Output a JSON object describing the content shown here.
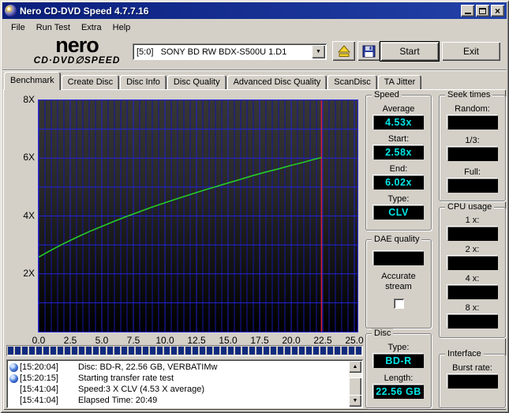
{
  "window": {
    "title": "Nero CD-DVD Speed 4.7.7.16"
  },
  "menu": {
    "items": [
      "File",
      "Run Test",
      "Extra",
      "Help"
    ]
  },
  "header": {
    "logo_line1": "nero",
    "logo_line2": "CD·DVD∅SPEED",
    "drive_selector_value": "[5:0]   SONY BD RW BDX-S500U 1.D1",
    "start_label": "Start",
    "exit_label": "Exit"
  },
  "tabs": {
    "items": [
      "Benchmark",
      "Create Disc",
      "Disc Info",
      "Disc Quality",
      "Advanced Disc Quality",
      "ScanDisc",
      "TA Jitter"
    ],
    "active": "Benchmark"
  },
  "chart_data": {
    "type": "line",
    "title": "",
    "xlabel": "",
    "ylabel": "",
    "xlim": [
      0,
      25.25
    ],
    "ylim": [
      0,
      8
    ],
    "x_ticks": [
      {
        "value": 0,
        "label": "0.0"
      },
      {
        "value": 2.5,
        "label": "2.5"
      },
      {
        "value": 5,
        "label": "5.0"
      },
      {
        "value": 7.5,
        "label": "7.5"
      },
      {
        "value": 10,
        "label": "10.0"
      },
      {
        "value": 12.5,
        "label": "12.5"
      },
      {
        "value": 15,
        "label": "15.0"
      },
      {
        "value": 17.5,
        "label": "17.5"
      },
      {
        "value": 20,
        "label": "20.0"
      },
      {
        "value": 22.5,
        "label": "22.5"
      },
      {
        "value": 25,
        "label": "25.0"
      }
    ],
    "y_ticks": [
      {
        "value": 8,
        "label": "8X"
      },
      {
        "value": 6,
        "label": "6X"
      },
      {
        "value": 4,
        "label": "4X"
      },
      {
        "value": 2,
        "label": "2X"
      }
    ],
    "grid": {
      "x_minor_step": 0.5,
      "x_major_every": 5,
      "y_step": 1
    },
    "series": [
      {
        "name": "read-transfer-rate",
        "points": [
          [
            0,
            2.58
          ],
          [
            1,
            2.82
          ],
          [
            2,
            3.05
          ],
          [
            3,
            3.26
          ],
          [
            4,
            3.46
          ],
          [
            5,
            3.64
          ],
          [
            6,
            3.82
          ],
          [
            7,
            3.99
          ],
          [
            8,
            4.15
          ],
          [
            9,
            4.31
          ],
          [
            10,
            4.46
          ],
          [
            11,
            4.6
          ],
          [
            12,
            4.74
          ],
          [
            13,
            4.88
          ],
          [
            14,
            5.01
          ],
          [
            15,
            5.14
          ],
          [
            16,
            5.27
          ],
          [
            17,
            5.4
          ],
          [
            18,
            5.52
          ],
          [
            19,
            5.63
          ],
          [
            20,
            5.75
          ],
          [
            21,
            5.86
          ],
          [
            22,
            5.98
          ],
          [
            22.4,
            6.02
          ]
        ]
      }
    ],
    "marker_line_x": 22.4,
    "legend": "none"
  },
  "panels": {
    "speed": {
      "title": "Speed",
      "average_label": "Average",
      "average": "4.53x",
      "start_label": "Start:",
      "start": "2.58x",
      "end_label": "End:",
      "end": "6.02x",
      "type_label": "Type:",
      "type": "CLV"
    },
    "seek": {
      "title": "Seek times",
      "random_label": "Random:",
      "random": "",
      "third_label": "1/3:",
      "third": "",
      "full_label": "Full:",
      "full": ""
    },
    "cpu": {
      "title": "CPU usage",
      "x1_label": "1 x:",
      "x1": "",
      "x2_label": "2 x:",
      "x2": "",
      "x4_label": "4 x:",
      "x4": "",
      "x8_label": "8 x:",
      "x8": ""
    },
    "dae": {
      "title": "DAE quality",
      "quality": "",
      "accurate_label_1": "Accurate",
      "accurate_label_2": "stream",
      "accurate_checked": false
    },
    "disc": {
      "title": "Disc",
      "type_label": "Type:",
      "type": "BD-R",
      "length_label": "Length:",
      "length": "22.56 GB"
    },
    "interface": {
      "title": "Interface",
      "burst_label": "Burst rate:",
      "burst": ""
    }
  },
  "progress": {
    "percent": 100
  },
  "log": {
    "lines": [
      {
        "icon": true,
        "time": "[15:20:04]",
        "text": "Disc: BD-R, 22.56 GB, VERBATIMw"
      },
      {
        "icon": true,
        "time": "[15:20:15]",
        "text": "Starting transfer rate test"
      },
      {
        "icon": false,
        "time": "[15:41:04]",
        "text": "Speed:3 X CLV (4.53 X average)"
      },
      {
        "icon": false,
        "time": "[15:41:04]",
        "text": "Elapsed Time: 20:49"
      }
    ]
  },
  "colors": {
    "lcd_text": "#00e6e6",
    "curve": "#25cc28",
    "marker_line": "#d42040",
    "grid_h": "#2525d8",
    "grid_v_minor": "#1414a8",
    "grid_v_major": "#1d1dd0",
    "titlebar": "#0a1e7c",
    "progress_fill": "#102a7e"
  }
}
